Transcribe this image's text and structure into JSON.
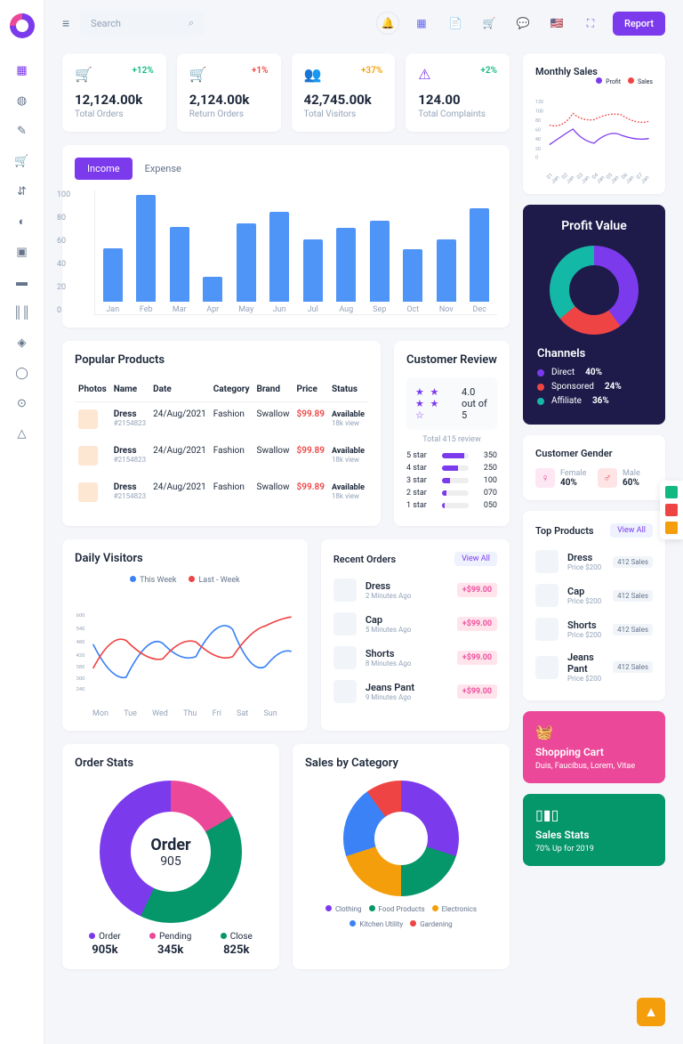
{
  "search_placeholder": "Search",
  "report_btn": "Report",
  "stats": [
    {
      "icon": "🛒",
      "icon_color": "green",
      "change": "+12%",
      "change_color": "green",
      "value": "12,124.00k",
      "label": "Total Orders"
    },
    {
      "icon": "🛒",
      "icon_color": "red",
      "change": "+1%",
      "change_color": "red",
      "value": "2,124.00k",
      "label": "Return Orders"
    },
    {
      "icon": "👥",
      "icon_color": "orange",
      "change": "+37%",
      "change_color": "orange",
      "value": "42,745.00k",
      "label": "Total Visitors"
    },
    {
      "icon": "⚠",
      "icon_color": "purple",
      "change": "+2%",
      "change_color": "green",
      "value": "124.00",
      "label": "Total Complaints"
    }
  ],
  "income_tabs": {
    "income": "Income",
    "expense": "Expense"
  },
  "monthly_sales": {
    "title": "Monthly Sales",
    "legend": [
      "Profit",
      "Sales"
    ],
    "x": [
      "01 Jan",
      "02 Jan",
      "03 Jan",
      "04 Jan",
      "05 Jan",
      "06 Jan",
      "07 Jan"
    ],
    "yticks": [
      "120",
      "100",
      "80",
      "60",
      "40",
      "20",
      "0"
    ]
  },
  "popular": {
    "title": "Popular Products",
    "headers": [
      "Photos",
      "Name",
      "Date",
      "Category",
      "Brand",
      "Price",
      "Status"
    ],
    "rows": [
      {
        "name": "Dress",
        "sku": "#2154823",
        "date": "24/Aug/2021",
        "cat": "Fashion",
        "brand": "Swallow",
        "price": "$99.89",
        "status": "Available",
        "views": "18k view"
      },
      {
        "name": "Dress",
        "sku": "#2154823",
        "date": "24/Aug/2021",
        "cat": "Fashion",
        "brand": "Swallow",
        "price": "$99.89",
        "status": "Available",
        "views": "18k view"
      },
      {
        "name": "Dress",
        "sku": "#2154823",
        "date": "24/Aug/2021",
        "cat": "Fashion",
        "brand": "Swallow",
        "price": "$99.89",
        "status": "Available",
        "views": "18k view"
      }
    ]
  },
  "review": {
    "title": "Customer Review",
    "rating": "4.0 out of 5",
    "sub": "Total 415 review",
    "breakdown": [
      {
        "label": "5 star",
        "pct": 85,
        "count": "350"
      },
      {
        "label": "4 star",
        "pct": 60,
        "count": "250"
      },
      {
        "label": "3 star",
        "pct": 30,
        "count": "100"
      },
      {
        "label": "2 star",
        "pct": 18,
        "count": "070"
      },
      {
        "label": "1 star",
        "pct": 10,
        "count": "050"
      }
    ]
  },
  "daily": {
    "title": "Daily Visitors",
    "legend": [
      "This Week",
      "Last - Week"
    ],
    "x": [
      "Mon",
      "Tue",
      "Wed",
      "Thu",
      "Fri",
      "Sat",
      "Sun"
    ],
    "yticks": [
      "600",
      "540",
      "480",
      "420",
      "380",
      "300",
      "240"
    ]
  },
  "recent": {
    "title": "Recent Orders",
    "view_all": "View All",
    "items": [
      {
        "name": "Dress",
        "time": "2 Minutes Ago",
        "price": "+$99.00"
      },
      {
        "name": "Cap",
        "time": "5 Minutes Ago",
        "price": "+$99.00"
      },
      {
        "name": "Shorts",
        "time": "8 Minutes Ago",
        "price": "+$99.00"
      },
      {
        "name": "Jeans Pant",
        "time": "9 Minutes Ago",
        "price": "+$99.00"
      }
    ]
  },
  "profit": {
    "title": "Profit Value",
    "channels_title": "Channels",
    "channels": [
      {
        "name": "Direct",
        "pct": "40%",
        "color": "#7c3aed"
      },
      {
        "name": "Sponsored",
        "pct": "24%",
        "color": "#ef4444"
      },
      {
        "name": "Affiliate",
        "pct": "36%",
        "color": "#14b8a6"
      }
    ]
  },
  "gender": {
    "title": "Customer Gender",
    "female": {
      "label": "Female",
      "pct": "40%"
    },
    "male": {
      "label": "Male",
      "pct": "60%"
    }
  },
  "top_products": {
    "title": "Top Products",
    "view_all": "View All",
    "items": [
      {
        "name": "Dress",
        "sub": "Price $200",
        "badge": "412 Sales"
      },
      {
        "name": "Cap",
        "sub": "Price $200",
        "badge": "412 Sales"
      },
      {
        "name": "Shorts",
        "sub": "Price $200",
        "badge": "412 Sales"
      },
      {
        "name": "Jeans Pant",
        "sub": "Price $200",
        "badge": "412 Sales"
      }
    ]
  },
  "order_stats": {
    "title": "Order Stats",
    "center_t": "Order",
    "center_v": "905",
    "items": [
      {
        "label": "Order",
        "value": "905k",
        "color": "#7c3aed"
      },
      {
        "label": "Pending",
        "value": "345k",
        "color": "#ec4899"
      },
      {
        "label": "Close",
        "value": "825k",
        "color": "#059669"
      }
    ]
  },
  "sales_cat": {
    "title": "Sales by Category",
    "legend": [
      {
        "label": "Clothing",
        "color": "#7c3aed"
      },
      {
        "label": "Food Products",
        "color": "#059669"
      },
      {
        "label": "Electronics",
        "color": "#f59e0b"
      },
      {
        "label": "Kitchen Utility",
        "color": "#3b82f6"
      },
      {
        "label": "Gardening",
        "color": "#ef4444"
      }
    ]
  },
  "promo1": {
    "title": "Shopping Cart",
    "sub": "Duis, Faucibus, Lorem, Vitae"
  },
  "promo2": {
    "title": "Sales Stats",
    "sub": "70% Up for 2019"
  },
  "chart_data": {
    "income_bar": {
      "type": "bar",
      "categories": [
        "Jan",
        "Feb",
        "Mar",
        "Apr",
        "May",
        "Jun",
        "Jul",
        "Aug",
        "Sep",
        "Oct",
        "Nov",
        "Dec"
      ],
      "values": [
        43,
        86,
        60,
        20,
        63,
        72,
        50,
        59,
        65,
        42,
        50,
        75
      ],
      "ylim": [
        0,
        100
      ],
      "yticks": [
        0,
        20,
        40,
        60,
        80,
        100
      ]
    },
    "monthly_sales": {
      "type": "line",
      "x": [
        "01 Jan",
        "02 Jan",
        "03 Jan",
        "04 Jan",
        "05 Jan",
        "06 Jan",
        "07 Jan"
      ],
      "series": [
        {
          "name": "Profit",
          "values": [
            30,
            45,
            60,
            35,
            30,
            50,
            40
          ],
          "color": "#7c3aed"
        },
        {
          "name": "Sales",
          "values": [
            65,
            60,
            85,
            70,
            75,
            85,
            65
          ],
          "color": "#ef4444"
        }
      ],
      "ylim": [
        0,
        120
      ]
    },
    "daily_visitors": {
      "type": "line",
      "x": [
        "Mon",
        "Tue",
        "Wed",
        "Thu",
        "Fri",
        "Sat",
        "Sun"
      ],
      "series": [
        {
          "name": "This Week",
          "values": [
            440,
            300,
            470,
            420,
            530,
            360,
            460
          ],
          "color": "#3b82f6"
        },
        {
          "name": "Last - Week",
          "values": [
            360,
            480,
            400,
            470,
            410,
            500,
            540
          ],
          "color": "#ef4444"
        }
      ],
      "ylim": [
        240,
        600
      ]
    },
    "profit_donut": {
      "type": "pie",
      "series": [
        {
          "name": "Direct",
          "value": 40
        },
        {
          "name": "Sponsored",
          "value": 24
        },
        {
          "name": "Affiliate",
          "value": 36
        }
      ]
    },
    "order_stats_donut": {
      "type": "pie",
      "series": [
        {
          "name": "Order",
          "value": 905
        },
        {
          "name": "Pending",
          "value": 345
        },
        {
          "name": "Close",
          "value": 825
        }
      ]
    },
    "sales_category_donut": {
      "type": "pie",
      "series": [
        {
          "name": "Clothing",
          "value": 30
        },
        {
          "name": "Food Products",
          "value": 20
        },
        {
          "name": "Electronics",
          "value": 20
        },
        {
          "name": "Kitchen Utility",
          "value": 20
        },
        {
          "name": "Gardening",
          "value": 10
        }
      ]
    }
  }
}
